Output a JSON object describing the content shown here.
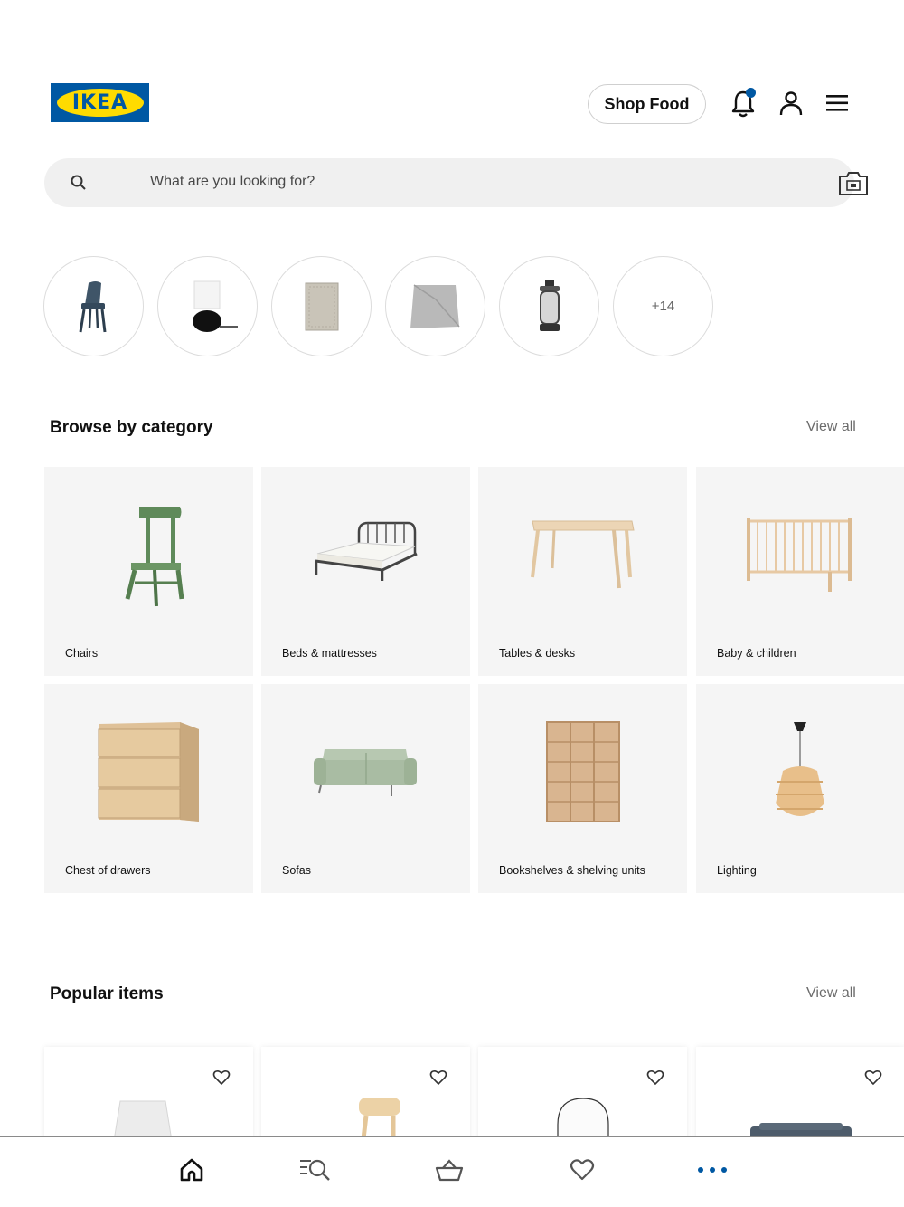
{
  "header": {
    "logo_text": "IKEA",
    "shop_food_label": "Shop Food",
    "notification_dot_color": "#0058a3"
  },
  "search": {
    "placeholder": "What are you looking for?"
  },
  "quick_categories": {
    "items": [
      "chair-thumbnail",
      "lamp-thumbnail",
      "rug-thumbnail",
      "throw-thumbnail",
      "lantern-thumbnail"
    ],
    "more_label": "+14"
  },
  "browse": {
    "title": "Browse by category",
    "view_all": "View all",
    "categories": [
      {
        "label": "Chairs"
      },
      {
        "label": "Beds & mattresses"
      },
      {
        "label": "Tables & desks"
      },
      {
        "label": "Baby & children"
      },
      {
        "label": "Chest of drawers"
      },
      {
        "label": "Sofas"
      },
      {
        "label": "Bookshelves & shelving units"
      },
      {
        "label": "Lighting"
      }
    ]
  },
  "popular": {
    "title": "Popular items",
    "view_all": "View all"
  },
  "bottom_nav": {
    "items": [
      "home-icon",
      "search-list-icon",
      "basket-icon",
      "heart-icon",
      "more-icon"
    ],
    "active_color": "#111111",
    "more_color": "#0058a3"
  },
  "colors": {
    "brand_blue": "#0058a3",
    "brand_yellow": "#ffdb00"
  }
}
